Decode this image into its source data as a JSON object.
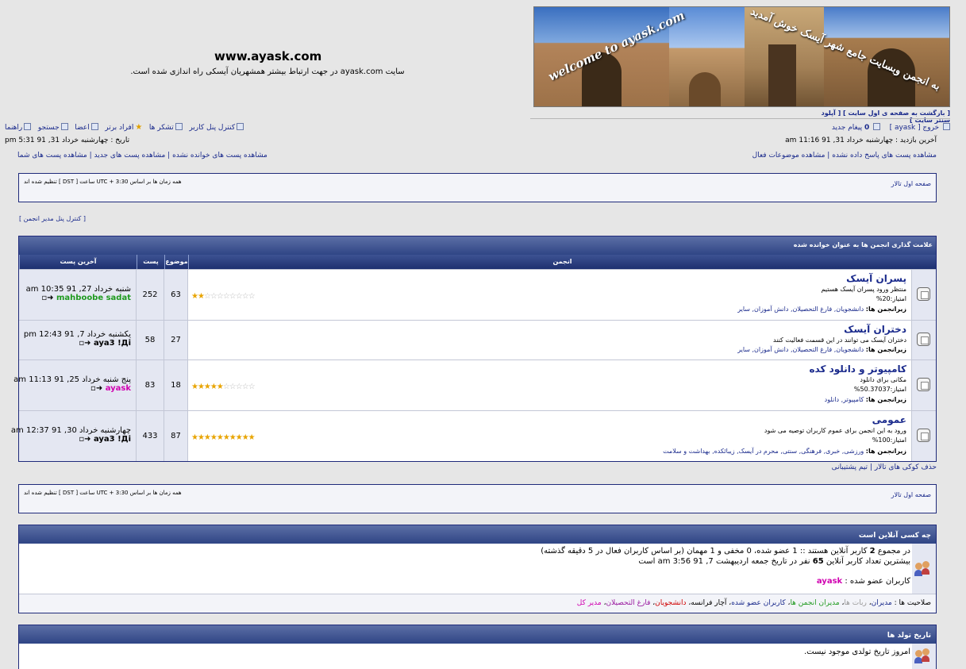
{
  "header": {
    "site_title": "www.ayask.com",
    "site_sub": "سایت ayask.com در جهت ارتباط بیشتر همشهریان آیسکی راه اندازی شده است.",
    "banner_text_en": "welcome to ayask.com",
    "banner_text_fa": "به انجمن وبسایت جامع شهر آیسک خوش آمدید",
    "top_links": "[ بازگشت به صفحه ی اول سایت ] [ آپلود سنتر سایت ]"
  },
  "nav": {
    "logout": "خروج [ ayask ]",
    "new_msgs_count": "0",
    "new_msgs": "پیغام جدید",
    "ucp": "کنترل پنل کاربر",
    "thanks": "تشکر ها",
    "top": "افراد برتر",
    "members": "اعضا",
    "search": "جستجو",
    "faq": "راهنما",
    "last_visit": "آخرین بازدید : چهارشنبه خرداد 31, 91 11:16 am",
    "current_date": "تاریخ : چهارشنبه خرداد 31, 91 5:31 pm",
    "view_unanswered": "مشاهده پست های پاسخ داده نشده",
    "view_active": "مشاهده موضوعات فعال",
    "view_unread": "مشاهده پست های خوانده نشده",
    "view_new": "مشاهده پست های جدید",
    "view_yours": "مشاهده پست های شما"
  },
  "timezone": "همه زمان ها بر اساس UTC + 3:30 ساعت [ DST ] تنظیم شده اند",
  "home_link": "صفحه اول تالار",
  "admin_panel": "[ کنترل پنل مدیر انجمن ]",
  "forum_table": {
    "mark_read": "علامت گذاری انجمن ها به عنوان خوانده شده",
    "col_forum": "انجمن",
    "col_topics": "موضوع ها",
    "col_posts": "پست",
    "col_last": "آخرین پست",
    "subforums_label": "زیرانجمن ها:",
    "rows": [
      {
        "title": "پسران آیسک",
        "desc": "منتظر ورود پسران آیسک هستیم",
        "score": "امتیاز:20%",
        "subs": "دانشجویان, فارغ التحصیلان, دانش آموزان, سایر",
        "stars_on": 2,
        "stars_total": 10,
        "topics": "63",
        "posts": "252",
        "last_date": "شنبه خرداد 27, 91 10:35 am",
        "last_user": "mahboobe sadat",
        "user_color": "#1f9a1f"
      },
      {
        "title": "دختران آیسک",
        "desc": "دختران آیسک می توانند در این قسمت فعالیت کنند",
        "score": "",
        "subs": "دانشجویان, فارغ التحصیلان, دانش آموزان, سایر",
        "stars_on": 0,
        "stars_total": 0,
        "topics": "27",
        "posts": "58",
        "last_date": "یکشنبه خرداد 7, 91 12:43 pm",
        "last_user": "aya3 !Дi",
        "user_color": "#111111"
      },
      {
        "title": "کامپیوتر و دانلود کده",
        "desc": "مکانی برای دانلود",
        "score": "امتیاز:50.37037%",
        "subs": "کامپیوتر, دانلود",
        "stars_on": 5,
        "stars_total": 10,
        "topics": "18",
        "posts": "83",
        "last_date": "پنج شنبه خرداد 25, 91 11:13 am",
        "last_user": "ayask",
        "user_color": "#d000b0"
      },
      {
        "title": "عمومی",
        "desc": "ورود به این انجمن برای عموم کاربران توصیه می شود",
        "score": "امتیاز:100%",
        "subs": "ورزشی, خبری, فرهنگی, سنتی, محرم در آیسک, زیبائکده, بهداشت و سلامت",
        "stars_on": 10,
        "stars_total": 10,
        "topics": "87",
        "posts": "433",
        "last_date": "چهارشنبه خرداد 30, 91 12:37 am",
        "last_user": "aya3 !Дi",
        "user_color": "#111111"
      }
    ]
  },
  "under_links": "حذف کوکی های تالار | تیم پشتیبانی",
  "online": {
    "title": "چه کسی آنلاین است",
    "line1_pre": "در مجموع",
    "line1_count": "2",
    "line1_post": "کاربر آنلاین هستند :: 1 عضو شده، 0 مخفی و 1 مهمان (بر اساس کاربران فعال در 5 دقیقه گذشته)",
    "line2_pre": "بیشترین تعداد کاربر آنلاین",
    "line2_count": "65",
    "line2_post": "نفر در تاریخ جمعه اردیبهشت 7, 91 3:56 am است",
    "registered_label": "کاربران عضو شده :",
    "registered_user": "ayask",
    "legend_label": "صلاحیت ها :",
    "legend": [
      {
        "name": "مدیران",
        "color": "#1a2a8c"
      },
      {
        "name": "ربات ها",
        "color": "#9a9a9a"
      },
      {
        "name": "مدیران انجمن ها",
        "color": "#1f9a1f"
      },
      {
        "name": "کاربران عضو شده",
        "color": "#1a2a8c"
      },
      {
        "name": "آچار فرانسه",
        "color": "#000000"
      },
      {
        "name": "دانشجویان",
        "color": "#d00000"
      },
      {
        "name": "فارغ التحصیلان",
        "color": "#9a1aa0"
      },
      {
        "name": "مدیر کل",
        "color": "#d000b0"
      }
    ]
  },
  "birthday": {
    "title": "تاریخ تولد ها",
    "text": "امروز تاریخ تولدی موجود نیست."
  }
}
